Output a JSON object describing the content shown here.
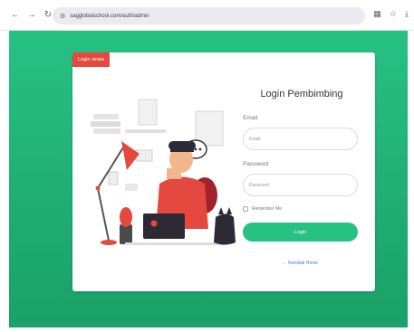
{
  "browser": {
    "url": "sagglobalschool.com/auth/admin",
    "back_icon": "←",
    "forward_icon": "→",
    "reload_icon": "↻",
    "tune_icon": "⚙",
    "extension_icon": "▦",
    "star_icon": "☆",
    "download_icon": "⤓"
  },
  "badge": {
    "label": "Login sinwa",
    "color": "#e5483f"
  },
  "form": {
    "title": "Login Pembimbing",
    "email_label": "Email",
    "email_placeholder": "Email",
    "password_label": "Password",
    "password_placeholder": "Password",
    "remember_label": "Remember Me",
    "login_label": "Login",
    "back_link": "← Kembali Home"
  },
  "theme": {
    "accent": "#27c184",
    "accent_dark": "#1aa068"
  }
}
